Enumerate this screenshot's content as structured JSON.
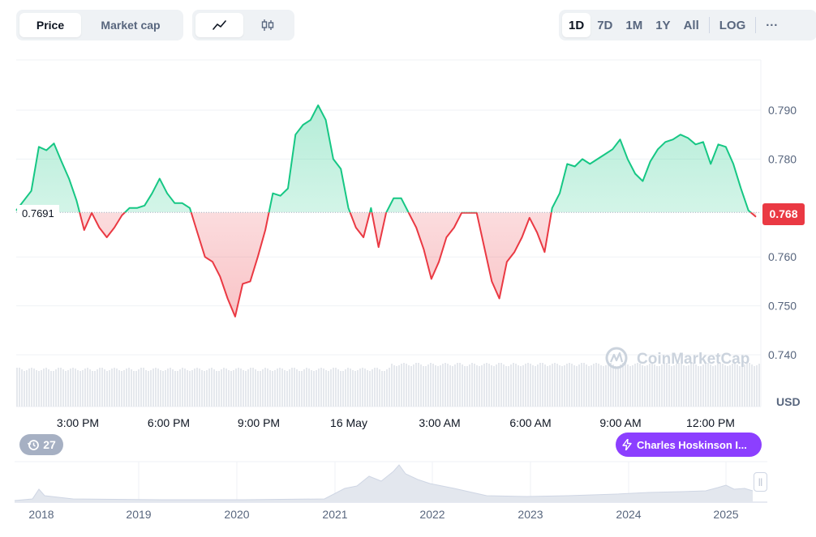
{
  "toolbar": {
    "metric_tabs": [
      {
        "label": "Price",
        "active": true
      },
      {
        "label": "Market cap",
        "active": false
      }
    ],
    "chart_types": [
      {
        "icon": "line-chart-icon",
        "active": true
      },
      {
        "icon": "candlestick-icon",
        "active": false
      }
    ],
    "ranges": [
      {
        "label": "1D",
        "active": true
      },
      {
        "label": "7D",
        "active": false
      },
      {
        "label": "1M",
        "active": false
      },
      {
        "label": "1Y",
        "active": false
      },
      {
        "label": "All",
        "active": false
      }
    ],
    "log_label": "LOG",
    "more_label": "···"
  },
  "chart": {
    "reference_label": "0.7691",
    "current_price_label": "0.768",
    "currency_label": "USD",
    "watermark": "CoinMarketCap",
    "event_count": "27",
    "news_label": "Charles Hoskinson I...",
    "colors": {
      "up": "#16c784",
      "down": "#ea3943",
      "news": "#8c3fff"
    }
  },
  "chart_data": {
    "type": "line",
    "reference_value": 0.7691,
    "current_value": 0.768,
    "ylim": [
      0.7365,
      0.7975
    ],
    "yticks": [
      "0.790",
      "0.780",
      "0.760",
      "0.750",
      "0.740"
    ],
    "xticks": [
      "3:00 PM",
      "6:00 PM",
      "9:00 PM",
      "16 May",
      "3:00 AM",
      "6:00 AM",
      "9:00 AM",
      "12:00 PM"
    ],
    "x_hours": [
      0,
      0.5,
      0.75,
      1,
      1.25,
      1.5,
      1.75,
      2,
      2.25,
      2.5,
      2.75,
      3,
      3.25,
      3.5,
      3.75,
      4,
      4.25,
      4.5,
      4.75,
      5,
      5.25,
      5.5,
      5.75,
      6,
      6.25,
      6.5,
      6.75,
      7,
      7.25,
      7.5,
      7.75,
      8,
      8.25,
      8.5,
      8.75,
      9,
      9.25,
      9.5,
      9.75,
      10,
      10.25,
      10.5,
      10.75,
      11,
      11.25,
      11.5,
      11.75,
      12,
      12.25,
      12.5,
      12.75,
      13,
      13.25,
      13.5,
      13.75,
      14,
      14.25,
      14.5,
      14.75,
      15,
      15.25,
      15.5,
      15.75,
      16,
      16.25,
      16.5,
      16.75,
      17,
      17.25,
      17.5,
      17.75,
      18,
      18.25,
      18.5,
      18.75,
      19,
      19.25,
      19.5,
      19.75,
      20,
      20.25,
      20.5,
      20.75,
      21,
      21.25,
      21.5,
      21.75,
      22,
      22.25,
      22.5,
      22.75,
      23,
      23.25,
      23.5,
      23.75,
      24,
      24.25,
      24.5
    ],
    "values": [
      0.7695,
      0.7735,
      0.7825,
      0.7818,
      0.7832,
      0.7795,
      0.776,
      0.7715,
      0.7655,
      0.769,
      0.766,
      0.764,
      0.766,
      0.7685,
      0.77,
      0.77,
      0.7705,
      0.773,
      0.776,
      0.773,
      0.771,
      0.771,
      0.77,
      0.765,
      0.76,
      0.759,
      0.756,
      0.7515,
      0.7478,
      0.7545,
      0.755,
      0.76,
      0.7655,
      0.773,
      0.7725,
      0.774,
      0.785,
      0.787,
      0.788,
      0.791,
      0.788,
      0.78,
      0.778,
      0.77,
      0.766,
      0.764,
      0.77,
      0.762,
      0.769,
      0.772,
      0.772,
      0.769,
      0.766,
      0.7615,
      0.7555,
      0.759,
      0.764,
      0.766,
      0.769,
      0.769,
      0.769,
      0.762,
      0.755,
      0.7515,
      0.759,
      0.761,
      0.764,
      0.768,
      0.765,
      0.761,
      0.77,
      0.773,
      0.779,
      0.7785,
      0.78,
      0.779,
      0.78,
      0.781,
      0.782,
      0.784,
      0.78,
      0.777,
      0.7755,
      0.7795,
      0.782,
      0.7835,
      0.784,
      0.785,
      0.7843,
      0.783,
      0.7835,
      0.779,
      0.783,
      0.7825,
      0.779,
      0.774,
      0.7695,
      0.7682
    ]
  },
  "navigator": {
    "years": [
      "2018",
      "2019",
      "2020",
      "2021",
      "2022",
      "2023",
      "2024",
      "2025"
    ]
  }
}
